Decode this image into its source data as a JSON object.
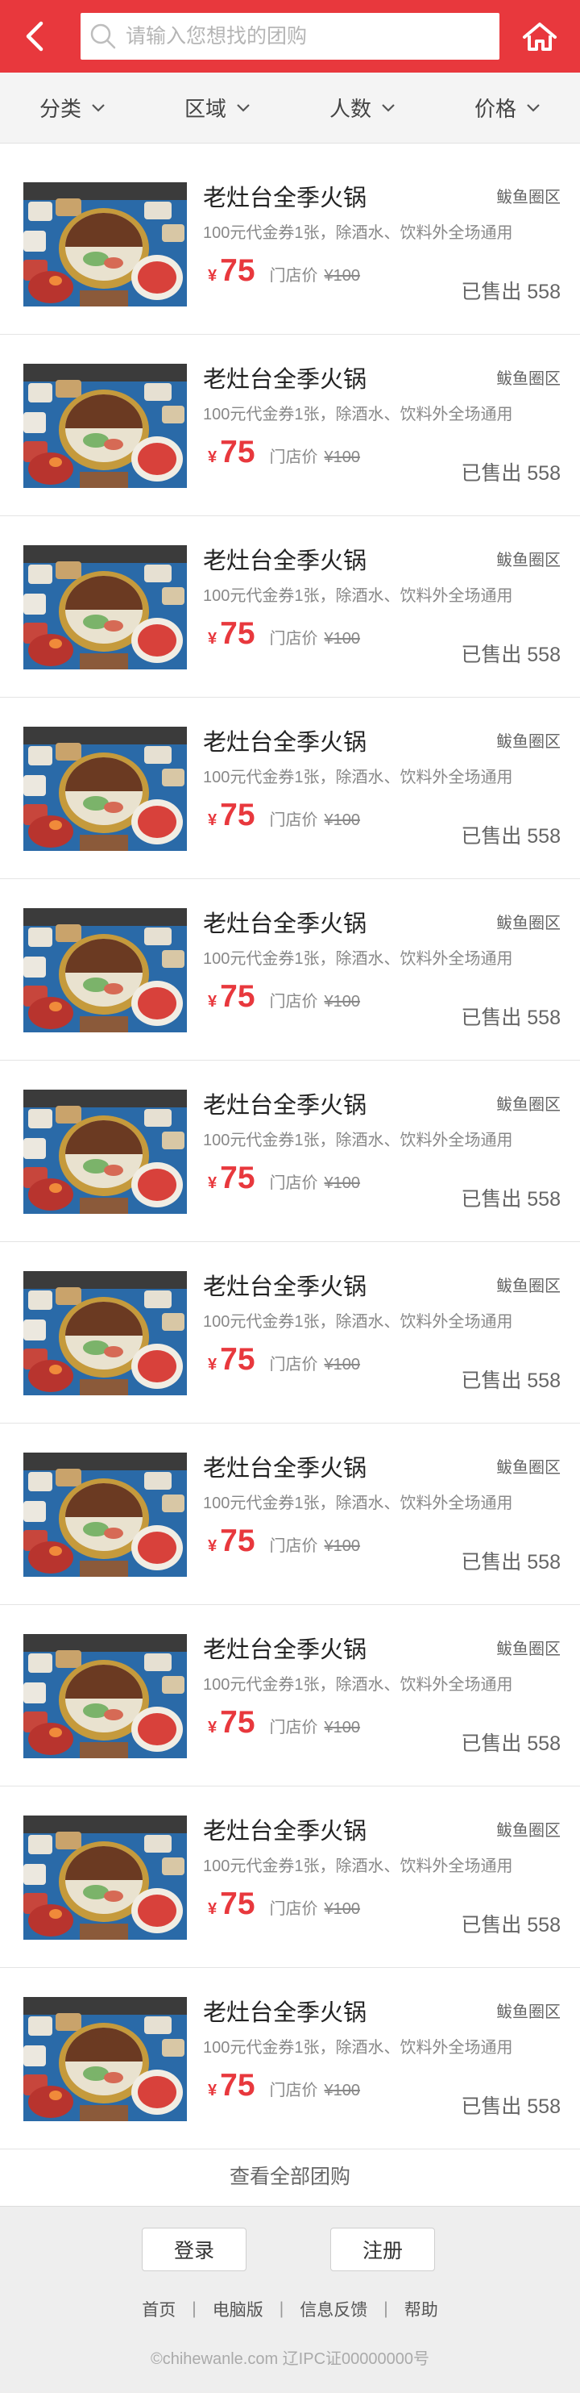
{
  "colors": {
    "brand": "#e8383d",
    "price": "#e8383d"
  },
  "header": {
    "back_icon": "chevron-left-icon",
    "search_icon": "search-icon",
    "search_placeholder": "请输入您想找的团购",
    "search_value": "",
    "home_icon": "home-icon"
  },
  "filters": [
    {
      "label": "分类",
      "icon": "chevron-down-icon"
    },
    {
      "label": "区域",
      "icon": "chevron-down-icon"
    },
    {
      "label": "人数",
      "icon": "chevron-down-icon"
    },
    {
      "label": "价格",
      "icon": "chevron-down-icon"
    }
  ],
  "deals": [
    {
      "title": "老灶台全季火锅",
      "area": "鲅鱼圈区",
      "desc": "100元代金券1张，除酒水、饮料外全场通用",
      "currency": "¥",
      "price": "75",
      "orig_label": "门店价",
      "orig_price": "¥100",
      "sold": "已售出 558"
    },
    {
      "title": "老灶台全季火锅",
      "area": "鲅鱼圈区",
      "desc": "100元代金券1张，除酒水、饮料外全场通用",
      "currency": "¥",
      "price": "75",
      "orig_label": "门店价",
      "orig_price": "¥100",
      "sold": "已售出 558"
    },
    {
      "title": "老灶台全季火锅",
      "area": "鲅鱼圈区",
      "desc": "100元代金券1张，除酒水、饮料外全场通用",
      "currency": "¥",
      "price": "75",
      "orig_label": "门店价",
      "orig_price": "¥100",
      "sold": "已售出 558"
    },
    {
      "title": "老灶台全季火锅",
      "area": "鲅鱼圈区",
      "desc": "100元代金券1张，除酒水、饮料外全场通用",
      "currency": "¥",
      "price": "75",
      "orig_label": "门店价",
      "orig_price": "¥100",
      "sold": "已售出 558"
    },
    {
      "title": "老灶台全季火锅",
      "area": "鲅鱼圈区",
      "desc": "100元代金券1张，除酒水、饮料外全场通用",
      "currency": "¥",
      "price": "75",
      "orig_label": "门店价",
      "orig_price": "¥100",
      "sold": "已售出 558"
    },
    {
      "title": "老灶台全季火锅",
      "area": "鲅鱼圈区",
      "desc": "100元代金券1张，除酒水、饮料外全场通用",
      "currency": "¥",
      "price": "75",
      "orig_label": "门店价",
      "orig_price": "¥100",
      "sold": "已售出 558"
    },
    {
      "title": "老灶台全季火锅",
      "area": "鲅鱼圈区",
      "desc": "100元代金券1张，除酒水、饮料外全场通用",
      "currency": "¥",
      "price": "75",
      "orig_label": "门店价",
      "orig_price": "¥100",
      "sold": "已售出 558"
    },
    {
      "title": "老灶台全季火锅",
      "area": "鲅鱼圈区",
      "desc": "100元代金券1张，除酒水、饮料外全场通用",
      "currency": "¥",
      "price": "75",
      "orig_label": "门店价",
      "orig_price": "¥100",
      "sold": "已售出 558"
    },
    {
      "title": "老灶台全季火锅",
      "area": "鲅鱼圈区",
      "desc": "100元代金券1张，除酒水、饮料外全场通用",
      "currency": "¥",
      "price": "75",
      "orig_label": "门店价",
      "orig_price": "¥100",
      "sold": "已售出 558"
    },
    {
      "title": "老灶台全季火锅",
      "area": "鲅鱼圈区",
      "desc": "100元代金券1张，除酒水、饮料外全场通用",
      "currency": "¥",
      "price": "75",
      "orig_label": "门店价",
      "orig_price": "¥100",
      "sold": "已售出 558"
    },
    {
      "title": "老灶台全季火锅",
      "area": "鲅鱼圈区",
      "desc": "100元代金券1张，除酒水、饮料外全场通用",
      "currency": "¥",
      "price": "75",
      "orig_label": "门店价",
      "orig_price": "¥100",
      "sold": "已售出 558"
    }
  ],
  "view_all": "查看全部团购",
  "footer": {
    "login": "登录",
    "register": "注册",
    "links": [
      "首页",
      "电脑版",
      "信息反馈",
      "帮助"
    ],
    "separator": "|",
    "copyright": "©chihewanle.com  辽IPC证00000000号"
  }
}
